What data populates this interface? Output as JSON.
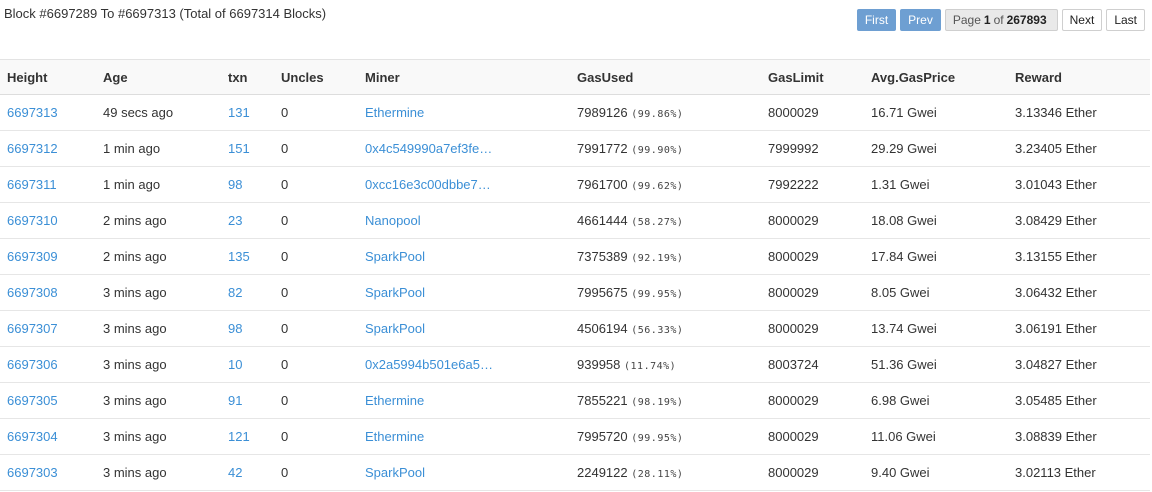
{
  "summary": "Block #6697289 To #6697313 (Total of 6697314 Blocks)",
  "pager": {
    "first": "First",
    "prev": "Prev",
    "page_word": "Page",
    "page_current": "1",
    "of_word": "of",
    "page_total": "267893",
    "next": "Next",
    "last": "Last"
  },
  "columns": [
    "Height",
    "Age",
    "txn",
    "Uncles",
    "Miner",
    "GasUsed",
    "GasLimit",
    "Avg.GasPrice",
    "Reward"
  ],
  "rows": [
    {
      "height": "6697313",
      "age": "49 secs ago",
      "txn": "131",
      "uncles": "0",
      "miner": "Ethermine",
      "gas_used": "7989126",
      "gas_pct": "(99.86%)",
      "gas_limit": "8000029",
      "gas_price": "16.71 Gwei",
      "reward": "3.13346 Ether"
    },
    {
      "height": "6697312",
      "age": "1 min ago",
      "txn": "151",
      "uncles": "0",
      "miner": "0x4c549990a7ef3fe…",
      "gas_used": "7991772",
      "gas_pct": "(99.90%)",
      "gas_limit": "7999992",
      "gas_price": "29.29 Gwei",
      "reward": "3.23405 Ether"
    },
    {
      "height": "6697311",
      "age": "1 min ago",
      "txn": "98",
      "uncles": "0",
      "miner": "0xcc16e3c00dbbe7…",
      "gas_used": "7961700",
      "gas_pct": "(99.62%)",
      "gas_limit": "7992222",
      "gas_price": "1.31 Gwei",
      "reward": "3.01043 Ether"
    },
    {
      "height": "6697310",
      "age": "2 mins ago",
      "txn": "23",
      "uncles": "0",
      "miner": "Nanopool",
      "gas_used": "4661444",
      "gas_pct": "(58.27%)",
      "gas_limit": "8000029",
      "gas_price": "18.08 Gwei",
      "reward": "3.08429 Ether"
    },
    {
      "height": "6697309",
      "age": "2 mins ago",
      "txn": "135",
      "uncles": "0",
      "miner": "SparkPool",
      "gas_used": "7375389",
      "gas_pct": "(92.19%)",
      "gas_limit": "8000029",
      "gas_price": "17.84 Gwei",
      "reward": "3.13155 Ether"
    },
    {
      "height": "6697308",
      "age": "3 mins ago",
      "txn": "82",
      "uncles": "0",
      "miner": "SparkPool",
      "gas_used": "7995675",
      "gas_pct": "(99.95%)",
      "gas_limit": "8000029",
      "gas_price": "8.05 Gwei",
      "reward": "3.06432 Ether"
    },
    {
      "height": "6697307",
      "age": "3 mins ago",
      "txn": "98",
      "uncles": "0",
      "miner": "SparkPool",
      "gas_used": "4506194",
      "gas_pct": "(56.33%)",
      "gas_limit": "8000029",
      "gas_price": "13.74 Gwei",
      "reward": "3.06191 Ether"
    },
    {
      "height": "6697306",
      "age": "3 mins ago",
      "txn": "10",
      "uncles": "0",
      "miner": "0x2a5994b501e6a5…",
      "gas_used": "939958",
      "gas_pct": "(11.74%)",
      "gas_limit": "8003724",
      "gas_price": "51.36 Gwei",
      "reward": "3.04827 Ether"
    },
    {
      "height": "6697305",
      "age": "3 mins ago",
      "txn": "91",
      "uncles": "0",
      "miner": "Ethermine",
      "gas_used": "7855221",
      "gas_pct": "(98.19%)",
      "gas_limit": "8000029",
      "gas_price": "6.98 Gwei",
      "reward": "3.05485 Ether"
    },
    {
      "height": "6697304",
      "age": "3 mins ago",
      "txn": "121",
      "uncles": "0",
      "miner": "Ethermine",
      "gas_used": "7995720",
      "gas_pct": "(99.95%)",
      "gas_limit": "8000029",
      "gas_price": "11.06 Gwei",
      "reward": "3.08839 Ether"
    },
    {
      "height": "6697303",
      "age": "3 mins ago",
      "txn": "42",
      "uncles": "0",
      "miner": "SparkPool",
      "gas_used": "2249122",
      "gas_pct": "(28.11%)",
      "gas_limit": "8000029",
      "gas_price": "9.40 Gwei",
      "reward": "3.02113 Ether"
    }
  ],
  "colors": {
    "link": "#3b8fd6",
    "pager_active": "#6e9fd2"
  }
}
